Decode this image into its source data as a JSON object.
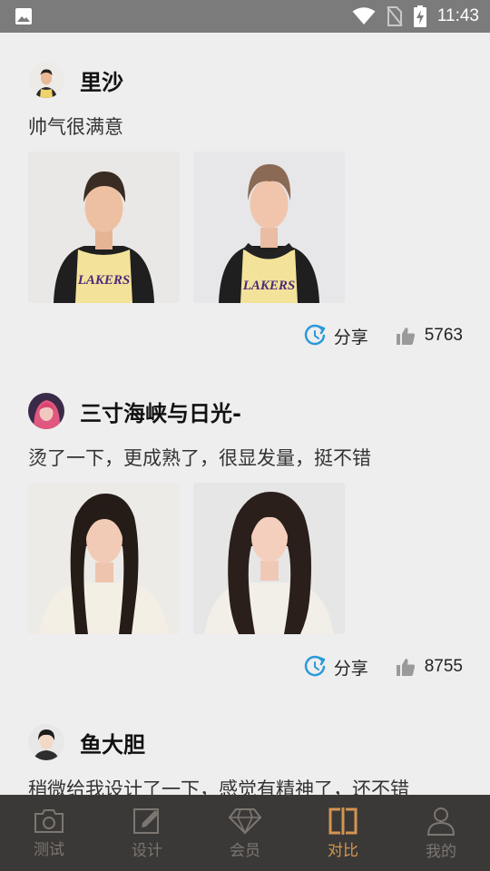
{
  "status_bar": {
    "time": "11:43"
  },
  "posts": [
    {
      "username": "里沙",
      "text": "帅气很满意",
      "share_label": "分享",
      "likes": "5763"
    },
    {
      "username": "三寸海峡与日光-",
      "text": "烫了一下，更成熟了，很显发量，挺不错",
      "share_label": "分享",
      "likes": "8755"
    },
    {
      "username": "鱼大胆",
      "text": "稍微给我设计了一下，感觉有精神了，还不错"
    }
  ],
  "bottom_nav": {
    "items": [
      {
        "label": "测试",
        "icon": "camera-icon"
      },
      {
        "label": "设计",
        "icon": "edit-icon"
      },
      {
        "label": "会员",
        "icon": "diamond-icon"
      },
      {
        "label": "对比",
        "icon": "compare-icon",
        "active": true
      },
      {
        "label": "我的",
        "icon": "profile-icon"
      }
    ]
  },
  "colors": {
    "status_bar": "#7b7b7b",
    "background": "#eeeeee",
    "nav_background": "#3b3937",
    "nav_active": "#d39451",
    "nav_inactive": "#7c7671",
    "share_accent": "#2a9ad8"
  }
}
